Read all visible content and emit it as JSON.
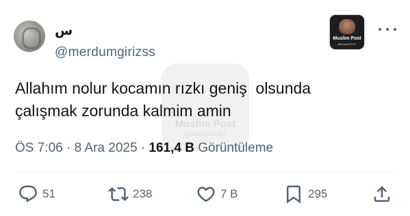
{
  "author": {
    "display_name": "س",
    "handle": "@merdumgirizss"
  },
  "badge": {
    "title": "Muslim Post",
    "subtitle": "@MuslimPOST"
  },
  "tweet": {
    "text": "Allahım nolur kocamın rızkı geniş  olsunda\nçalışmak zorunda kalmim amin"
  },
  "watermark": {
    "title": "Muslim Post",
    "subtitle": "@MuslimPOST"
  },
  "meta": {
    "time": "ÖS 7:06",
    "separator1": " · ",
    "date": "8 Ara 2025",
    "separator2": " · ",
    "views_count": "161,4 B",
    "views_label": " Görüntüleme"
  },
  "actions": {
    "replies": "51",
    "retweets": "238",
    "likes": "7 B",
    "bookmarks": "295"
  },
  "icons": {
    "reply": "reply-icon",
    "retweet": "retweet-icon",
    "like": "heart-icon",
    "bookmark": "bookmark-icon",
    "share": "share-icon",
    "more": "more-icon"
  },
  "colors": {
    "text_primary": "#0f1419",
    "text_secondary": "#536471"
  }
}
